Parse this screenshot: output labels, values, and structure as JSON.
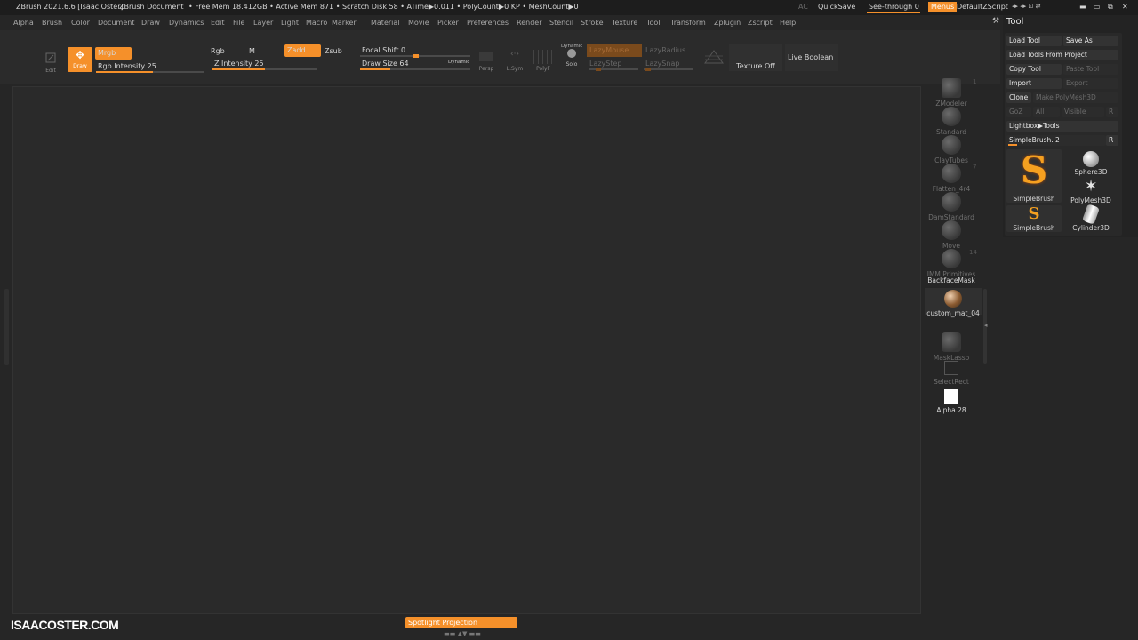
{
  "titlebar": {
    "app": "ZBrush 2021.6.6 [Isaac Oster]",
    "doc": "ZBrush Document",
    "stats": "• Free Mem 18.412GB • Active Mem 871 • Scratch Disk 58 • ATime▶0.011 • PolyCount▶0 KP • MeshCount▶0",
    "ac": "AC",
    "quicksave": "QuickSave",
    "seethrough": "See-through  0",
    "menus": "Menus",
    "script": "DefaultZScript"
  },
  "menubar": {
    "items": [
      "Alpha",
      "Brush",
      "Color",
      "Document",
      "Draw",
      "Dynamics",
      "Edit",
      "File",
      "Layer",
      "Light",
      "Macro",
      "Marker",
      "Material",
      "Movie",
      "Picker",
      "Preferences",
      "Render",
      "Stencil",
      "Stroke",
      "Texture",
      "Tool",
      "Transform",
      "Zplugin",
      "Zscript",
      "Help"
    ]
  },
  "shelf": {
    "edit": "Edit",
    "draw": "Draw",
    "mrgb": "Mrgb",
    "rgb_intensity": "Rgb Intensity 25",
    "rgb": "Rgb",
    "m": "M",
    "zadd": "Zadd",
    "zsub": "Zsub",
    "z_intensity": "Z Intensity 25",
    "focal_shift": "Focal Shift 0",
    "draw_size": "Draw Size 64",
    "dynamic": "Dynamic",
    "persp": "Persp",
    "lsym": "L.Sym",
    "polyf": "PolyF",
    "solo_dynamic": "Dynamic",
    "solo": "Solo",
    "lazymouse": "LazyMouse",
    "lazyradius": "LazyRadius",
    "lazystep": "LazyStep",
    "lazysnap": "LazySnap",
    "texture_off": "Texture Off",
    "live_boolean": "Live Boolean"
  },
  "rightshelf": {
    "zmodeler": "ZModeler",
    "zmodeler_count": "1",
    "standard": "Standard",
    "claytubes": "ClayTubes",
    "flatten": "Flatten_4r4",
    "flatten_count": "7",
    "damstandard": "DamStandard",
    "move": "Move",
    "imm": "IMM Primitives",
    "imm_count": "14",
    "backfacemask": "BackfaceMask",
    "material": "custom_mat_04",
    "masklasso": "MaskLasso",
    "selectrect": "SelectRect",
    "alpha": "Alpha 28"
  },
  "toolpanel": {
    "title": "Tool",
    "load_tool": "Load Tool",
    "save_as": "Save As",
    "load_from_project": "Load Tools From Project",
    "copy_tool": "Copy Tool",
    "paste_tool": "Paste Tool",
    "import": "Import",
    "export": "Export",
    "clone": "Clone",
    "make_polymesh": "Make PolyMesh3D",
    "goz": "GoZ",
    "all": "All",
    "visible": "Visible",
    "r": "R",
    "lightbox_tools": "Lightbox▶Tools",
    "current": "SimpleBrush. 2",
    "r2": "R",
    "thumbs": [
      "SimpleBrush",
      "Sphere3D",
      "PolyMesh3D",
      "SimpleBrush",
      "Cylinder3D"
    ]
  },
  "bottom": {
    "watermark": "ISAACOSTER.COM",
    "spotlight": "Spotlight Projection"
  },
  "colors": {
    "accent": "#f5902a",
    "bg": "#262626"
  }
}
